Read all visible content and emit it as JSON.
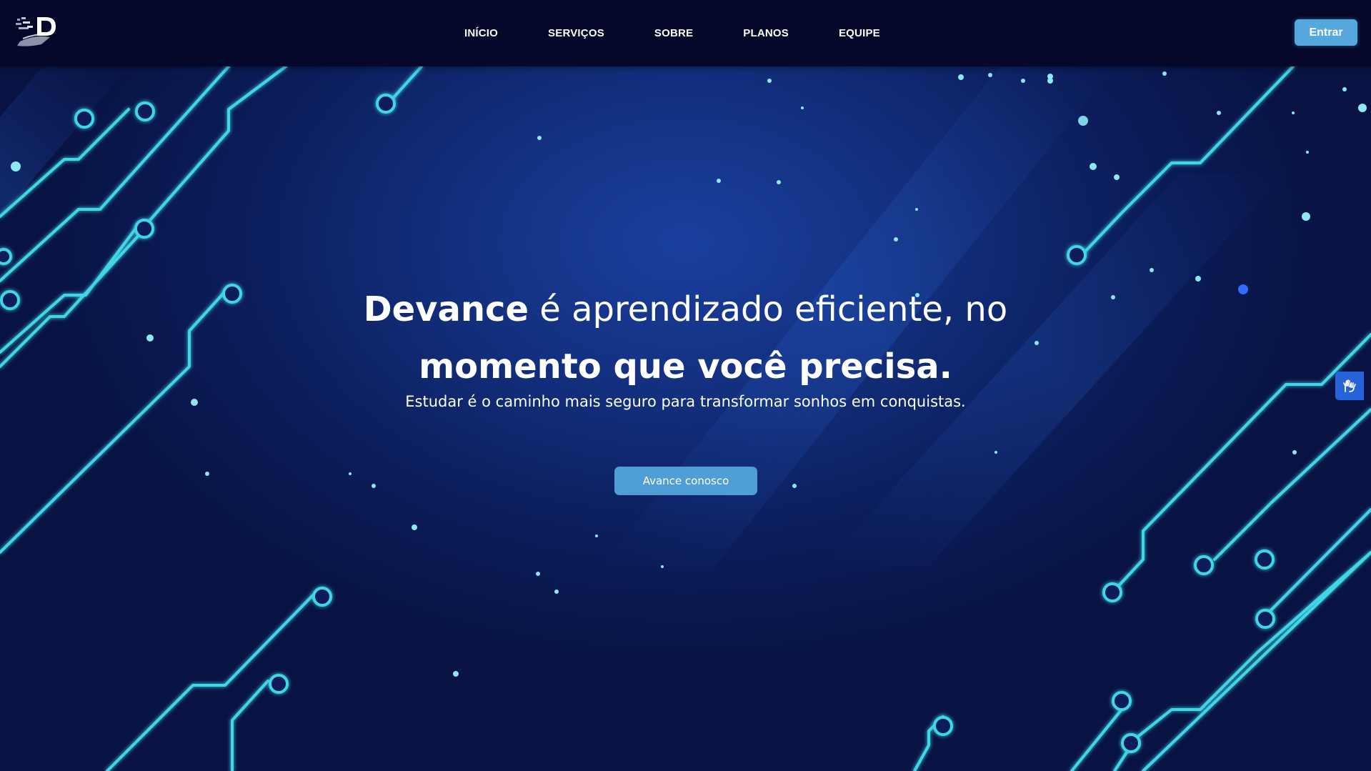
{
  "nav": {
    "logo_alt": "D",
    "links": [
      "INÍCIO",
      "SERVIÇOS",
      "SOBRE",
      "PLANOS",
      "EQUIPE"
    ],
    "login_label": "Entrar"
  },
  "hero": {
    "headline_brand": "Devance",
    "headline_rest": " é aprendizado eficiente, no",
    "headline_line2": "momento que você precisa.",
    "subtitle": "Estudar é o caminho mais seguro para transformar sonhos em conquistas.",
    "cta_label": "Avance conosco"
  },
  "accessibility": {
    "icon": "sign-language-hands-icon"
  },
  "colors": {
    "nav_bg": "#05082a",
    "button_blue": "#55a7de",
    "circuit_cyan": "#3fd6e6",
    "hero_bg": "#13307f"
  }
}
